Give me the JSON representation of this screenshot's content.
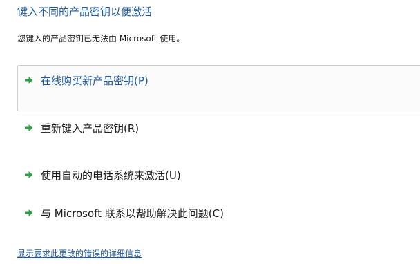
{
  "title": "键入不同的产品密钥以便激活",
  "subtitle": "您键入的产品密钥已无法由 Microsoft 使用。",
  "options": [
    {
      "label": "在线购买新产品密钥(P)",
      "icon": "green-arrow-icon",
      "selected": true
    },
    {
      "label": "重新键入产品密钥(R)",
      "icon": "green-arrow-icon",
      "selected": false
    },
    {
      "label": "使用自动的电话系统来激活(U)",
      "icon": "green-arrow-icon",
      "selected": false
    },
    {
      "label": "与 Microsoft 联系以帮助解决此问题(C)",
      "icon": "green-arrow-icon",
      "selected": false
    }
  ],
  "details_link": "显示要求此更改的错误的详细信息",
  "colors": {
    "accent": "#1e5aa0",
    "arrow": "#2ea043",
    "selected_border": "#cccccc"
  }
}
